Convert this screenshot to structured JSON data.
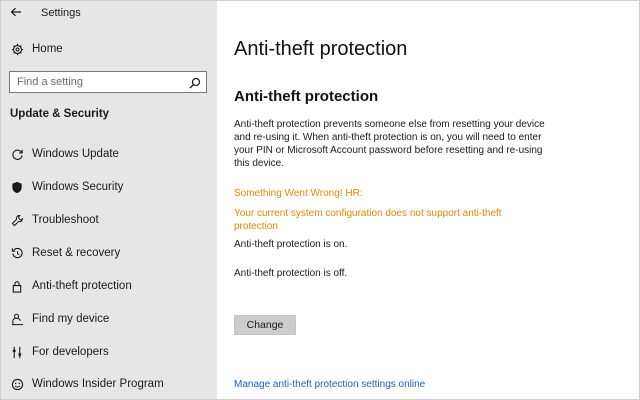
{
  "window": {
    "app_title": "Settings"
  },
  "sidebar": {
    "home_label": "Home",
    "search": {
      "placeholder": "Find a setting",
      "value": ""
    },
    "section_heading": "Update & Security",
    "items": [
      {
        "label": "Windows Update",
        "icon": "refresh-icon"
      },
      {
        "label": "Windows Security",
        "icon": "shield-icon"
      },
      {
        "label": "Troubleshoot",
        "icon": "wrench-icon"
      },
      {
        "label": "Reset & recovery",
        "icon": "recovery-icon"
      },
      {
        "label": "Anti-theft protection",
        "icon": "lock-icon"
      },
      {
        "label": "Find my device",
        "icon": "person-pin-icon"
      },
      {
        "label": "For developers",
        "icon": "developer-sliders-icon"
      },
      {
        "label": "Windows Insider Program",
        "icon": "smiley-icon"
      }
    ]
  },
  "main": {
    "page_title": "Anti-theft protection",
    "section_title": "Anti-theft protection",
    "description": "Anti-theft protection prevents someone else from resetting your device and re-using it. When anti-theft protection is on, you will need to enter your PIN or Microsoft Account password before resetting and re-using this device.",
    "error_title": "Something Went Wrong! HR:",
    "error_message": "Your current system configuration does not support anti-theft protection",
    "status_on": "Anti-theft protection is on.",
    "status_off": "Anti-theft protection is off.",
    "change_button": "Change",
    "manage_link": "Manage anti-theft protection settings online"
  },
  "colors": {
    "sidebar_bg": "#e6e6e6",
    "warning": "#e08a00",
    "link": "#1f5fbf",
    "button_bg": "#cccccc"
  }
}
